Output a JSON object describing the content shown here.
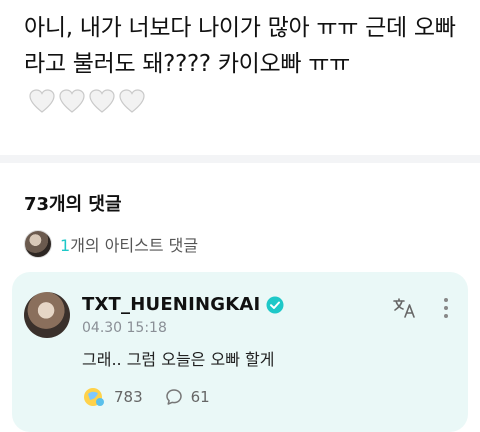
{
  "post": {
    "text": "아니, 내가 너보다 나이가 많아 ㅠㅠ 근데 오빠라고 불러도 돼???? 카이오빠 ㅠㅠ"
  },
  "comments": {
    "count_label": "73개의 댓글",
    "artist_count": "1",
    "artist_label": "개의 아티스트 댓글"
  },
  "comment": {
    "author": "TXT_HUENINGKAI",
    "time": "04.30 15:18",
    "body": "그래.. 그럼 오늘은 오빠 할게",
    "likes": "783",
    "replies": "61"
  },
  "colors": {
    "accent": "#1ec8c8",
    "card_bg": "#eaf8f7"
  }
}
